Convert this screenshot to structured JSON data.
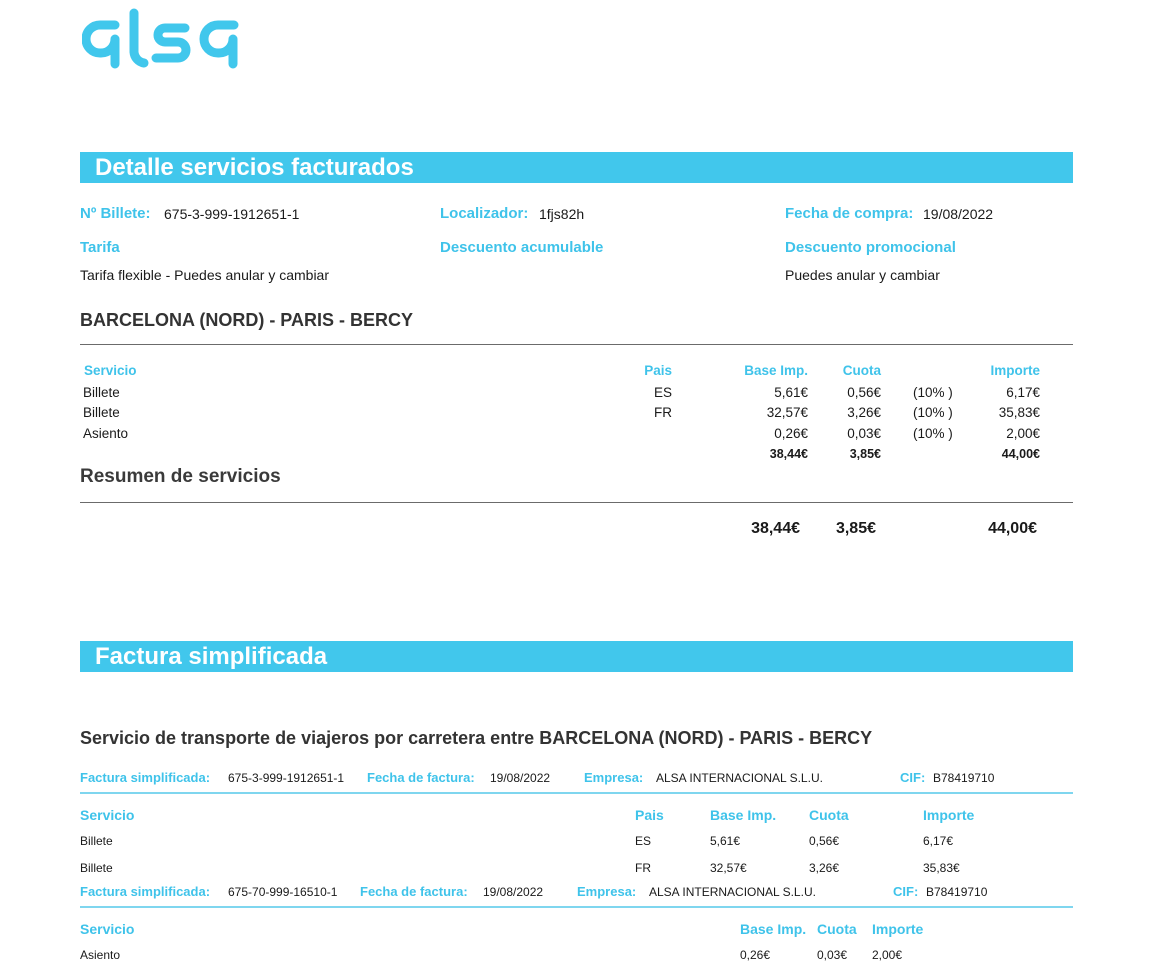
{
  "brand": {
    "logo_text": "alsa",
    "accent_color": "#41c7ec"
  },
  "detalle": {
    "title": "Detalle servicios facturados",
    "billete_label": "Nº Billete:",
    "billete_value": "675-3-999-1912651-1",
    "localizador_label": "Localizador:",
    "localizador_value": "1fjs82h",
    "fecha_compra_label": "Fecha de compra:",
    "fecha_compra_value": "19/08/2022",
    "tarifa_label": "Tarifa",
    "tarifa_value": "Tarifa flexible - Puedes anular y cambiar",
    "descuento_acumulable_label": "Descuento acumulable",
    "descuento_promocional_label": "Descuento promocional",
    "descuento_promocional_value": "Puedes anular y cambiar",
    "route": "BARCELONA (NORD) - PARIS - BERCY",
    "table": {
      "headers": {
        "servicio": "Servicio",
        "pais": "Pais",
        "base": "Base Imp.",
        "cuota": "Cuota",
        "importe": "Importe"
      },
      "rows": [
        {
          "servicio": "Billete",
          "pais": "ES",
          "base": "5,61€",
          "cuota": "0,56€",
          "iva": "(10% )",
          "importe": "6,17€"
        },
        {
          "servicio": "Billete",
          "pais": "FR",
          "base": "32,57€",
          "cuota": "3,26€",
          "iva": "(10% )",
          "importe": "35,83€"
        },
        {
          "servicio": "Asiento",
          "pais": "",
          "base": "0,26€",
          "cuota": "0,03€",
          "iva": "(10% )",
          "importe": "2,00€"
        }
      ],
      "subtotal": {
        "base": "38,44€",
        "cuota": "3,85€",
        "importe": "44,00€"
      }
    },
    "resumen_title": "Resumen de servicios",
    "resumen": {
      "base": "38,44€",
      "cuota": "3,85€",
      "importe": "44,00€"
    }
  },
  "factura": {
    "title": "Factura simplificada",
    "description": "Servicio de transporte de viajeros por carretera entre BARCELONA (NORD) - PARIS - BERCY",
    "invoices": [
      {
        "factura_label": "Factura simplificada:",
        "factura_value": "675-3-999-1912651-1",
        "fecha_label": "Fecha de factura:",
        "fecha_value": "19/08/2022",
        "empresa_label": "Empresa:",
        "empresa_value": "ALSA INTERNACIONAL S.L.U.",
        "cif_label": "CIF:",
        "cif_value": "B78419710",
        "headers": {
          "servicio": "Servicio",
          "pais": "Pais",
          "base": "Base Imp.",
          "cuota": "Cuota",
          "importe": "Importe"
        },
        "rows": [
          {
            "servicio": "Billete",
            "pais": "ES",
            "base": "5,61€",
            "cuota": "0,56€",
            "importe": "6,17€"
          },
          {
            "servicio": "Billete",
            "pais": "FR",
            "base": "32,57€",
            "cuota": "3,26€",
            "importe": "35,83€"
          }
        ]
      },
      {
        "factura_label": "Factura simplificada:",
        "factura_value": "675-70-999-16510-1",
        "fecha_label": "Fecha de factura:",
        "fecha_value": "19/08/2022",
        "empresa_label": "Empresa:",
        "empresa_value": "ALSA INTERNACIONAL S.L.U.",
        "cif_label": "CIF:",
        "cif_value": "B78419710",
        "headers": {
          "servicio": "Servicio",
          "base": "Base Imp.",
          "cuota": "Cuota",
          "importe": "Importe"
        },
        "rows": [
          {
            "servicio": "Asiento",
            "base": "0,26€",
            "cuota": "0,03€",
            "importe": "2,00€"
          }
        ]
      }
    ]
  }
}
